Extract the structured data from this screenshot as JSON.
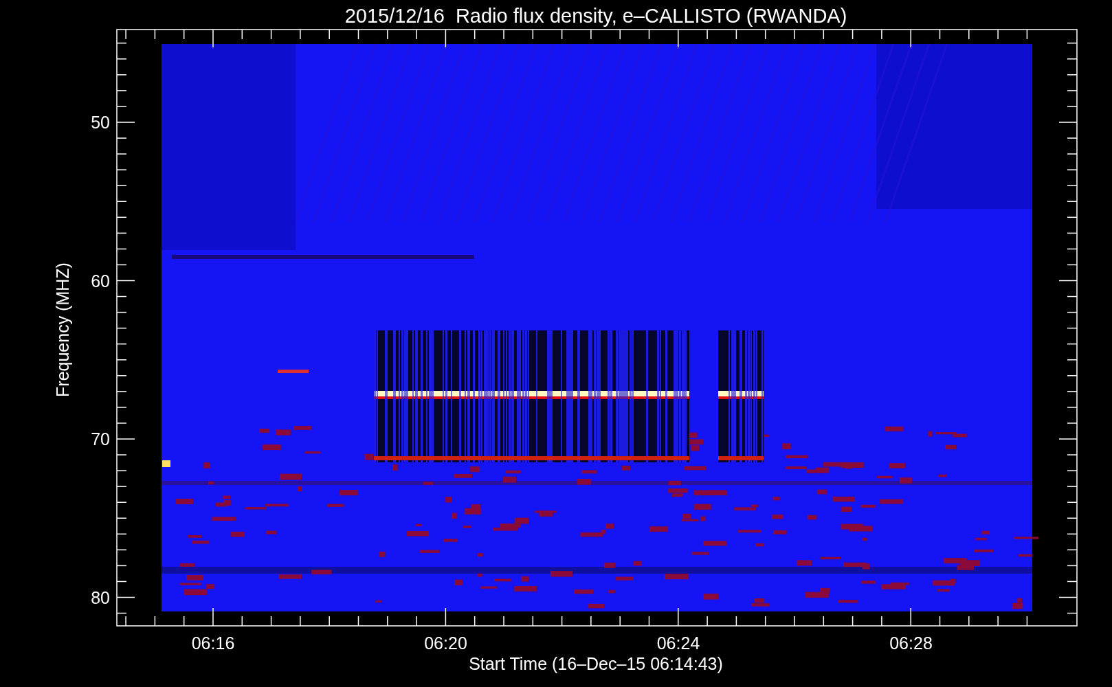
{
  "title": "2015/12/16  Radio flux density, e–CALLISTO (RWANDA)",
  "ylabel": "Frequency (MHZ)",
  "xlabel": "Start Time (16–Dec–15 06:14:43)",
  "yticks": [
    "50",
    "60",
    "70",
    "80"
  ],
  "xticks": [
    "06:16",
    "06:20",
    "06:24",
    "06:28"
  ]
}
